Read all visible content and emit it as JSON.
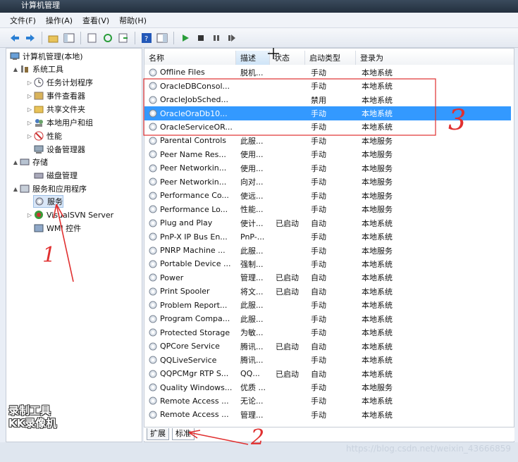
{
  "window": {
    "title": "计算机管理"
  },
  "menu": [
    "文件(F)",
    "操作(A)",
    "查看(V)",
    "帮助(H)"
  ],
  "toolbar": [
    "back-arrow-icon",
    "forward-arrow-icon",
    "folder-up-icon",
    "console-tree-icon",
    "export-icon",
    "refresh-icon",
    "export-list-icon",
    "help-icon",
    "show-hide-icon",
    "play-icon",
    "stop-icon",
    "pause-icon",
    "restart-icon"
  ],
  "tree": [
    {
      "label": "计算机管理(本地)",
      "level": 0,
      "arrow": "",
      "icon": "computer-icon"
    },
    {
      "label": "系统工具",
      "level": 1,
      "arrow": "▲",
      "icon": "tools-icon"
    },
    {
      "label": "任务计划程序",
      "level": 2,
      "arrow": "▷",
      "icon": "clock-icon"
    },
    {
      "label": "事件查看器",
      "level": 2,
      "arrow": "▷",
      "icon": "event-viewer-icon"
    },
    {
      "label": "共享文件夹",
      "level": 2,
      "arrow": "▷",
      "icon": "shared-folder-icon"
    },
    {
      "label": "本地用户和组",
      "level": 2,
      "arrow": "▷",
      "icon": "users-icon"
    },
    {
      "label": "性能",
      "level": 2,
      "arrow": "▷",
      "icon": "performance-icon"
    },
    {
      "label": "设备管理器",
      "level": 2,
      "arrow": "",
      "icon": "device-manager-icon"
    },
    {
      "label": "存储",
      "level": 1,
      "arrow": "▲",
      "icon": "storage-icon"
    },
    {
      "label": "磁盘管理",
      "level": 2,
      "arrow": "",
      "icon": "disk-icon"
    },
    {
      "label": "服务和应用程序",
      "level": 1,
      "arrow": "▲",
      "icon": "services-apps-icon"
    },
    {
      "label": "服务",
      "level": 2,
      "arrow": "",
      "icon": "gear-icon",
      "selected": true
    },
    {
      "label": "VisualSVN Server",
      "level": 2,
      "arrow": "▷",
      "icon": "svn-icon"
    },
    {
      "label": "WMI 控件",
      "level": 2,
      "arrow": "",
      "icon": "wmi-icon"
    }
  ],
  "columns": [
    "名称",
    "描述",
    "状态",
    "启动类型",
    "登录为"
  ],
  "services": [
    {
      "name": "Offline Files",
      "desc": "脱机...",
      "status": "",
      "startup": "手动",
      "logon": "本地系统"
    },
    {
      "name": "OracleDBConsol...",
      "desc": "",
      "status": "",
      "startup": "手动",
      "logon": "本地系统"
    },
    {
      "name": "OracleJobSched...",
      "desc": "",
      "status": "",
      "startup": "禁用",
      "logon": "本地系统"
    },
    {
      "name": "OracleOraDb10...",
      "desc": "",
      "status": "",
      "startup": "手动",
      "logon": "本地系统",
      "selected": true
    },
    {
      "name": "OracleServiceOR...",
      "desc": "",
      "status": "",
      "startup": "手动",
      "logon": "本地系统"
    },
    {
      "name": "Parental Controls",
      "desc": "此服...",
      "status": "",
      "startup": "手动",
      "logon": "本地服务"
    },
    {
      "name": "Peer Name Res...",
      "desc": "使用...",
      "status": "",
      "startup": "手动",
      "logon": "本地服务"
    },
    {
      "name": "Peer Networkin...",
      "desc": "使用...",
      "status": "",
      "startup": "手动",
      "logon": "本地服务"
    },
    {
      "name": "Peer Networkin...",
      "desc": "向对...",
      "status": "",
      "startup": "手动",
      "logon": "本地服务"
    },
    {
      "name": "Performance Co...",
      "desc": "使远...",
      "status": "",
      "startup": "手动",
      "logon": "本地服务"
    },
    {
      "name": "Performance Lo...",
      "desc": "性能...",
      "status": "",
      "startup": "手动",
      "logon": "本地服务"
    },
    {
      "name": "Plug and Play",
      "desc": "使计...",
      "status": "已启动",
      "startup": "自动",
      "logon": "本地系统"
    },
    {
      "name": "PnP-X IP Bus En...",
      "desc": "PnP-...",
      "status": "",
      "startup": "手动",
      "logon": "本地系统"
    },
    {
      "name": "PNRP Machine ...",
      "desc": "此服...",
      "status": "",
      "startup": "手动",
      "logon": "本地服务"
    },
    {
      "name": "Portable Device ...",
      "desc": "强制...",
      "status": "",
      "startup": "手动",
      "logon": "本地系统"
    },
    {
      "name": "Power",
      "desc": "管理...",
      "status": "已启动",
      "startup": "自动",
      "logon": "本地系统"
    },
    {
      "name": "Print Spooler",
      "desc": "将文...",
      "status": "已启动",
      "startup": "自动",
      "logon": "本地系统"
    },
    {
      "name": "Problem Report...",
      "desc": "此服...",
      "status": "",
      "startup": "手动",
      "logon": "本地系统"
    },
    {
      "name": "Program Compa...",
      "desc": "此服...",
      "status": "",
      "startup": "手动",
      "logon": "本地系统"
    },
    {
      "name": "Protected Storage",
      "desc": "为敏...",
      "status": "",
      "startup": "手动",
      "logon": "本地系统"
    },
    {
      "name": "QPCore Service",
      "desc": "腾讯...",
      "status": "已启动",
      "startup": "自动",
      "logon": "本地系统"
    },
    {
      "name": "QQLiveService",
      "desc": "腾讯...",
      "status": "",
      "startup": "手动",
      "logon": "本地系统"
    },
    {
      "name": "QQPCMgr RTP S...",
      "desc": "QQ...",
      "status": "已启动",
      "startup": "自动",
      "logon": "本地系统"
    },
    {
      "name": "Quality Windows...",
      "desc": "优质 ...",
      "status": "",
      "startup": "手动",
      "logon": "本地服务"
    },
    {
      "name": "Remote Access ...",
      "desc": "无论...",
      "status": "",
      "startup": "手动",
      "logon": "本地系统"
    },
    {
      "name": "Remote Access ...",
      "desc": "管理...",
      "status": "",
      "startup": "手动",
      "logon": "本地系统"
    }
  ],
  "tabs": [
    "扩展",
    "标准"
  ],
  "recorder_mark": [
    "录制工具",
    "KK录像机"
  ],
  "watermark": "https://blog.csdn.net/weixin_43666859",
  "annotations": [
    "1",
    "2",
    "3"
  ],
  "colors": {
    "selection": "#3399ff",
    "annotation": "#e03030"
  }
}
